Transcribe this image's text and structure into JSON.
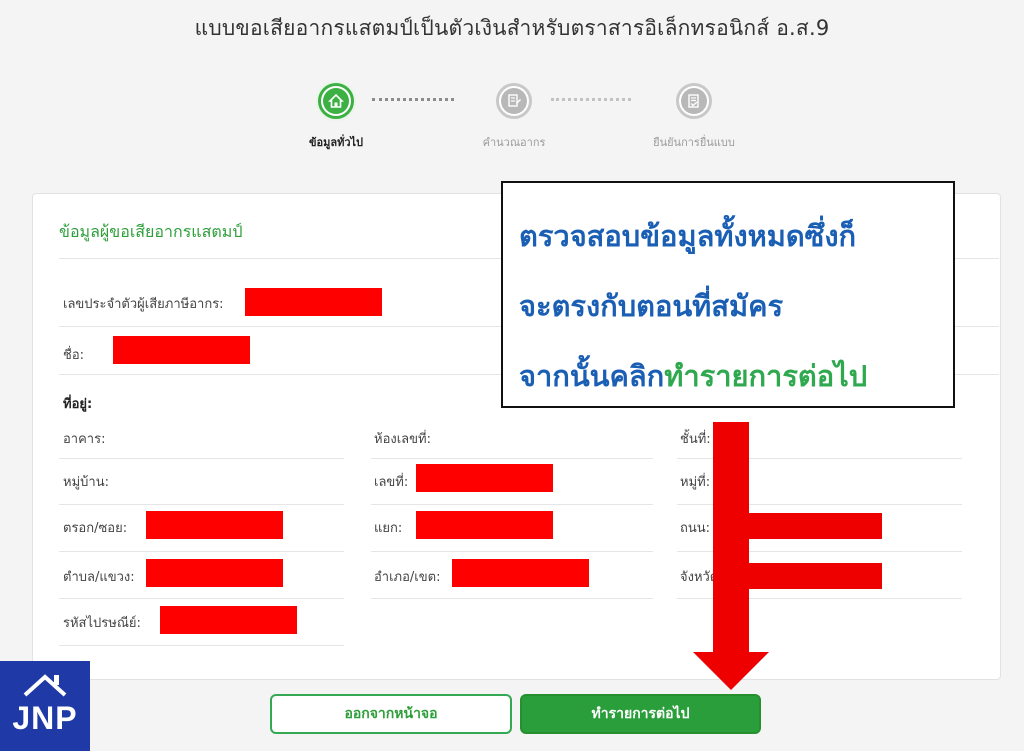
{
  "page": {
    "title": "แบบขอเสียอากรแสตมป์เป็นตัวเงินสำหรับตราสารอิเล็กทรอนิกส์ อ.ส.9"
  },
  "steps": [
    {
      "label": "ข้อมูลทั่วไป",
      "icon": "home-icon",
      "active": true
    },
    {
      "label": "คำนวณอากร",
      "icon": "calculator-document-icon",
      "active": false
    },
    {
      "label": "ยืนยันการยื่นแบบ",
      "icon": "confirm-document-icon",
      "active": false
    }
  ],
  "section": {
    "title": "ข้อมูลผู้ขอเสียอากรแสตมป์"
  },
  "fields": {
    "tax_id_label": "เลขประจำตัวผู้เสียภาษีอากร:",
    "name_label": "ชื่อ:",
    "address_heading": "ที่อยู่:",
    "building_label": "อาคาร:",
    "room_label": "ห้องเลขที่:",
    "floor_label": "ชั้นที่:",
    "village_label": "หมู่บ้าน:",
    "house_no_label": "เลขที่:",
    "moo_label": "หมู่ที่:",
    "alley_label": "ตรอก/ซอย:",
    "junction_label": "แยก:",
    "road_label": "ถนน:",
    "subdistrict_label": "ตำบล/แขวง:",
    "district_label": "อำเภอ/เขต:",
    "province_label": "จังหวัด:",
    "postcode_label": "รหัสไปรษณีย์:"
  },
  "callout": {
    "line1": "ตรวจสอบข้อมูลทั้งหมดซึ่งก็",
    "line2": "จะตรงกับตอนที่สมัคร",
    "line3_prefix": "จากนั้นคลิก",
    "line3_action": "ทำรายการต่อไป"
  },
  "buttons": {
    "exit": "ออกจากหน้าจอ",
    "next": "ทำรายการต่อไป"
  },
  "logo": {
    "text": "JNP"
  },
  "colors": {
    "primary_green": "#2b9e3c",
    "callout_blue": "#1a5fb4",
    "redaction_red": "#ff0000",
    "logo_blue": "#1f3aa6"
  }
}
